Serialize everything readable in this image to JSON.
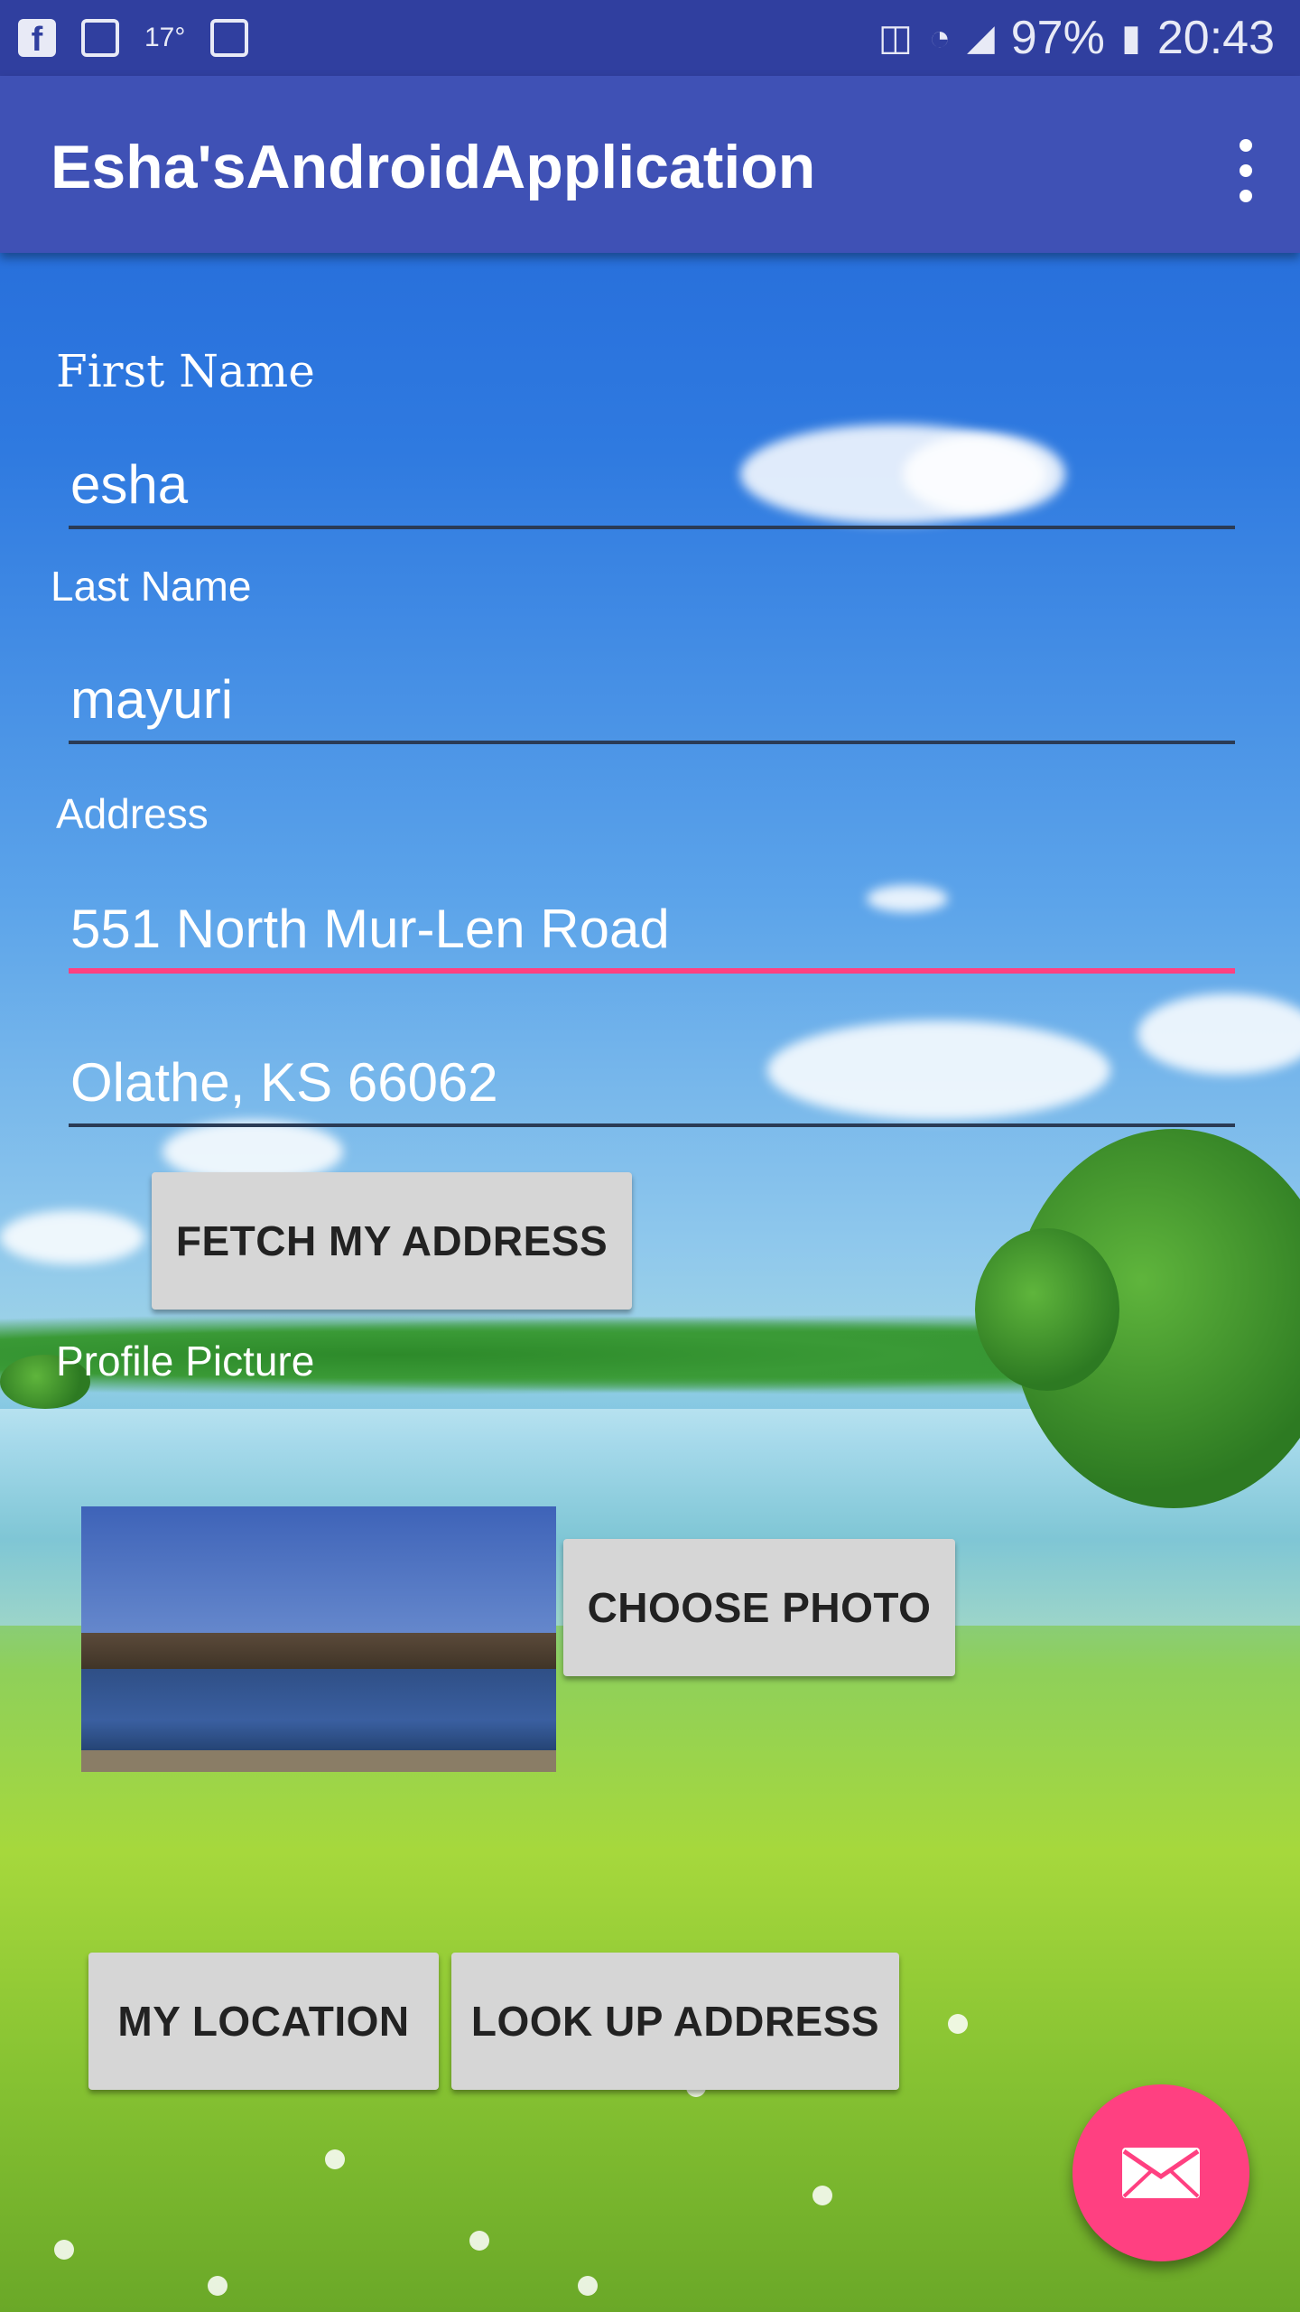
{
  "status_bar": {
    "temperature": "17°",
    "battery": "97%",
    "time": "20:43"
  },
  "app_bar": {
    "title": "Esha'sAndroidApplication"
  },
  "form": {
    "first_name_label": "First Name",
    "first_name_value": "esha",
    "last_name_label": "Last Name",
    "last_name_value": "mayuri",
    "address_label": "Address",
    "address_line1": "551 North Mur-Len Road",
    "address_line2": "Olathe, KS 66062",
    "fetch_button": "FETCH MY ADDRESS",
    "profile_picture_label": "Profile Picture",
    "choose_photo_button": "CHOOSE PHOTO",
    "my_location_button": "MY LOCATION",
    "look_up_button": "LOOK UP ADDRESS"
  },
  "colors": {
    "status_bar": "#303f9f",
    "app_bar": "#3f51b5",
    "accent": "#ff4081",
    "button": "#d6d6d6"
  },
  "icons": {
    "fab": "email-icon",
    "overflow": "more-vert-icon"
  }
}
